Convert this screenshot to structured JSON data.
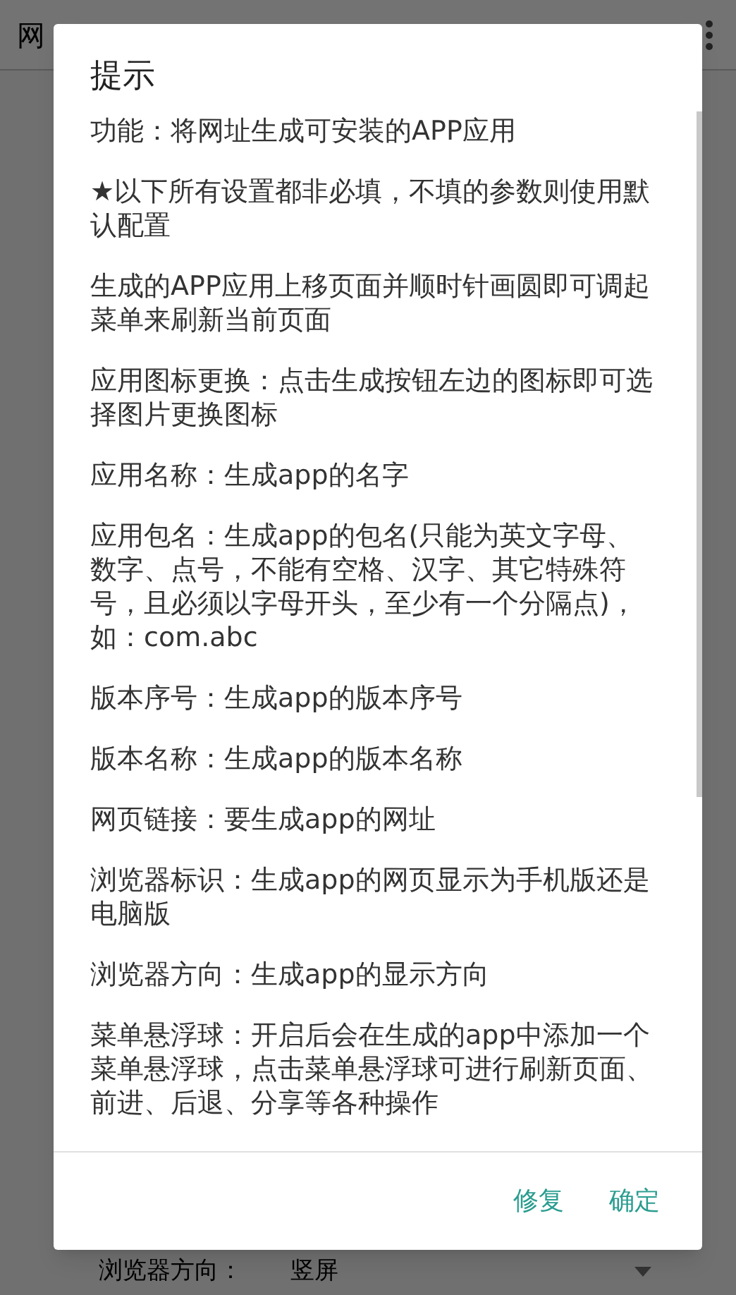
{
  "app_bar": {
    "title": "网"
  },
  "dialog": {
    "title": "提示",
    "paragraphs": [
      "功能：将网址生成可安装的APP应用",
      "★以下所有设置都非必填，不填的参数则使用默认配置",
      "生成的APP应用上移页面并顺时针画圆即可调起菜单来刷新当前页面",
      "应用图标更换：点击生成按钮左边的图标即可选择图片更换图标",
      "应用名称：生成app的名字",
      "应用包名：生成app的包名(只能为英文字母、数字、点号，不能有空格、汉字、其它特殊符号，且必须以字母开头，至少有一个分隔点)，如：com.abc",
      "版本序号：生成app的版本序号",
      "版本名称：生成app的版本名称",
      "网页链接：要生成app的网址",
      "浏览器标识：生成app的网页显示为手机版还是电脑版",
      "浏览器方向：生成app的显示方向",
      "菜单悬浮球：开启后会在生成的app中添加一个菜单悬浮球，点击菜单悬浮球可进行刷新页面、前进、后退、分享等各种操作"
    ],
    "buttons": [
      "修复",
      "确定"
    ]
  },
  "background_form": {
    "label": "浏览器方向：",
    "value": "竖屏"
  }
}
